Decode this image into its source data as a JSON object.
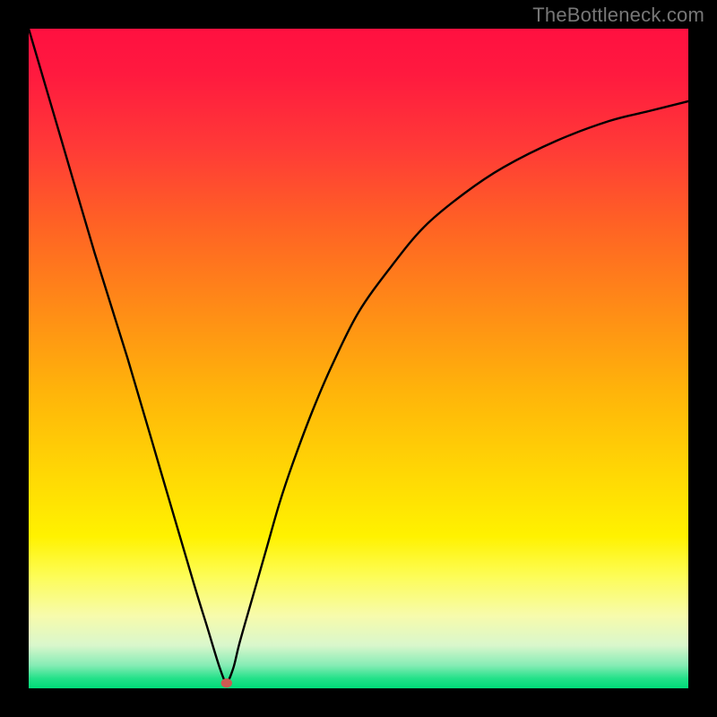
{
  "watermark": "TheBottleneck.com",
  "chart_data": {
    "type": "line",
    "title": "",
    "xlabel": "",
    "ylabel": "",
    "xlim": [
      0,
      100
    ],
    "ylim": [
      0,
      100
    ],
    "grid": false,
    "legend": false,
    "background_gradient": [
      {
        "stop": 0.0,
        "color": "#ff1040"
      },
      {
        "stop": 0.07,
        "color": "#ff1a3f"
      },
      {
        "stop": 0.18,
        "color": "#ff3a37"
      },
      {
        "stop": 0.3,
        "color": "#ff6324"
      },
      {
        "stop": 0.42,
        "color": "#ff8a17"
      },
      {
        "stop": 0.55,
        "color": "#ffb40a"
      },
      {
        "stop": 0.68,
        "color": "#ffd904"
      },
      {
        "stop": 0.77,
        "color": "#fff200"
      },
      {
        "stop": 0.83,
        "color": "#fdfd57"
      },
      {
        "stop": 0.89,
        "color": "#f7fbac"
      },
      {
        "stop": 0.935,
        "color": "#d9f7cc"
      },
      {
        "stop": 0.965,
        "color": "#86ecb5"
      },
      {
        "stop": 0.985,
        "color": "#23e189"
      },
      {
        "stop": 1.0,
        "color": "#00db78"
      }
    ],
    "series": [
      {
        "name": "curve",
        "stroke": "#000000",
        "x": [
          0,
          5,
          10,
          15,
          20,
          25,
          27,
          29,
          30,
          31,
          32,
          34,
          36,
          38,
          40,
          43,
          46,
          50,
          55,
          60,
          66,
          72,
          80,
          88,
          94,
          100
        ],
        "values": [
          100,
          83,
          66,
          50,
          33,
          16,
          9.5,
          3,
          1,
          3,
          7,
          14,
          21,
          28,
          34,
          42,
          49,
          57,
          64,
          70,
          75,
          79,
          83,
          86,
          87.5,
          89
        ]
      }
    ],
    "marker": {
      "x": 30,
      "y": 0.8,
      "r": 0.7,
      "color": "#cc5b52"
    }
  }
}
